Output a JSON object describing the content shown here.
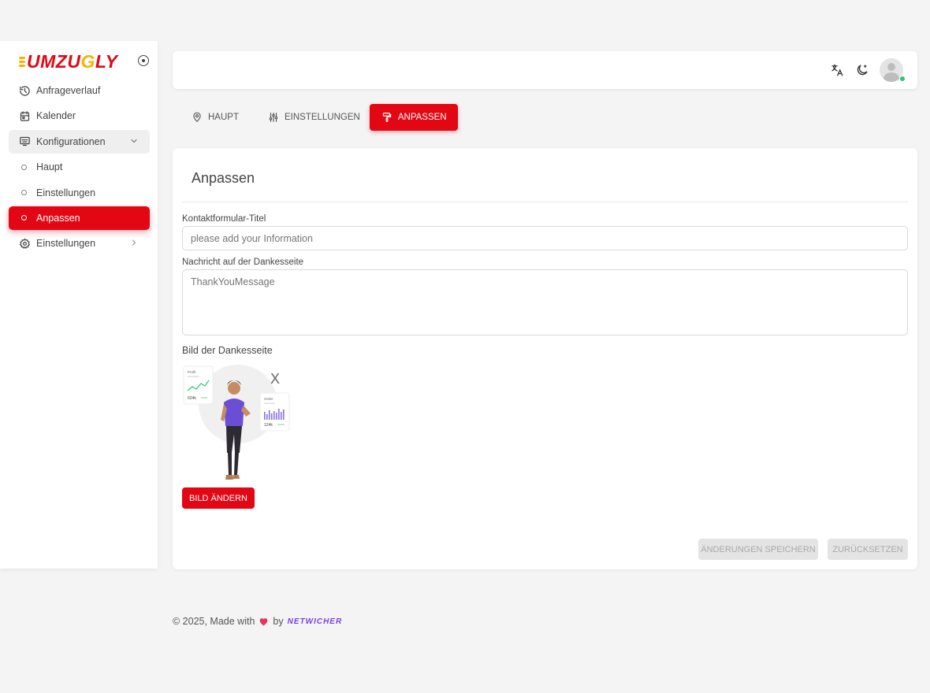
{
  "brand": {
    "prefix": "UMZU",
    "highlight": "G",
    "suffix": "LY"
  },
  "sidebar": {
    "items": [
      {
        "label": "Anfrageverlauf",
        "icon": "history-icon"
      },
      {
        "label": "Kalender",
        "icon": "calendar-icon"
      },
      {
        "label": "Konfigurationen",
        "icon": "config-icon",
        "expanded": true
      },
      {
        "label": "Einstellungen",
        "icon": "gear-icon"
      }
    ],
    "subitems": [
      {
        "label": "Haupt"
      },
      {
        "label": "Einstellungen"
      },
      {
        "label": "Anpassen",
        "active": true
      }
    ]
  },
  "tabs": [
    {
      "label": "HAUPT",
      "icon": "location-icon"
    },
    {
      "label": "EINSTELLUNGEN",
      "icon": "sliders-icon"
    },
    {
      "label": "ANPASSEN",
      "icon": "paint-roller-icon",
      "active": true
    }
  ],
  "card": {
    "title": "Anpassen",
    "contact_title_label": "Kontaktformular-Titel",
    "contact_title_placeholder": "please add your Information",
    "thanks_message_label": "Nachricht auf der Dankesseite",
    "thanks_message_placeholder": "ThankYouMessage",
    "image_label": "Bild der Dankesseite",
    "image_remove": "X",
    "preview": {
      "card1_title": "Profit",
      "card1_sub": "Last Month",
      "card1_value": "624k",
      "card2_title": "Order",
      "card2_sub": "Last week",
      "card2_value": "124k"
    },
    "change_image_button": "BILD ÄNDERN",
    "save_button": "ÄNDERUNGEN SPEICHERN",
    "reset_button": "ZURÜCKSETZEN"
  },
  "footer": {
    "text": "© 2025, Made with",
    "by": "by",
    "company": "NETWICHER"
  },
  "colors": {
    "primary": "#e30613",
    "accent": "#f6b400",
    "online": "#28c76f"
  }
}
